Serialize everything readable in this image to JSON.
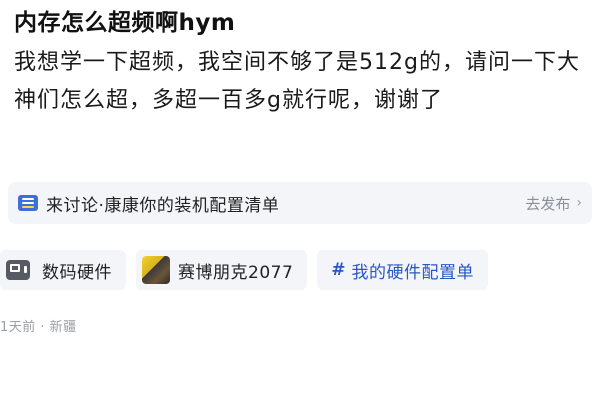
{
  "post": {
    "title": "内存怎么超频啊hym",
    "body": "我想学一下超频，我空间不够了是512g的，请问一下大神们怎么超，多超一百多g就行呢，谢谢了"
  },
  "topic": {
    "icon": "topic-badge-icon",
    "text": "来讨论·康康你的装机配置清单",
    "action_label": "去发布",
    "action_icon": "chevron-right-icon",
    "chevron": "›"
  },
  "tags": [
    {
      "icon": "device-icon",
      "label": "数码硬件"
    },
    {
      "icon": "game-thumbnail-icon",
      "label": "赛博朋克2077"
    },
    {
      "icon": "hashtag-icon",
      "symbol": "#",
      "label": "我的硬件配置单",
      "color": "#2a56c6"
    }
  ],
  "meta": {
    "text": "1天前 · 新疆"
  }
}
